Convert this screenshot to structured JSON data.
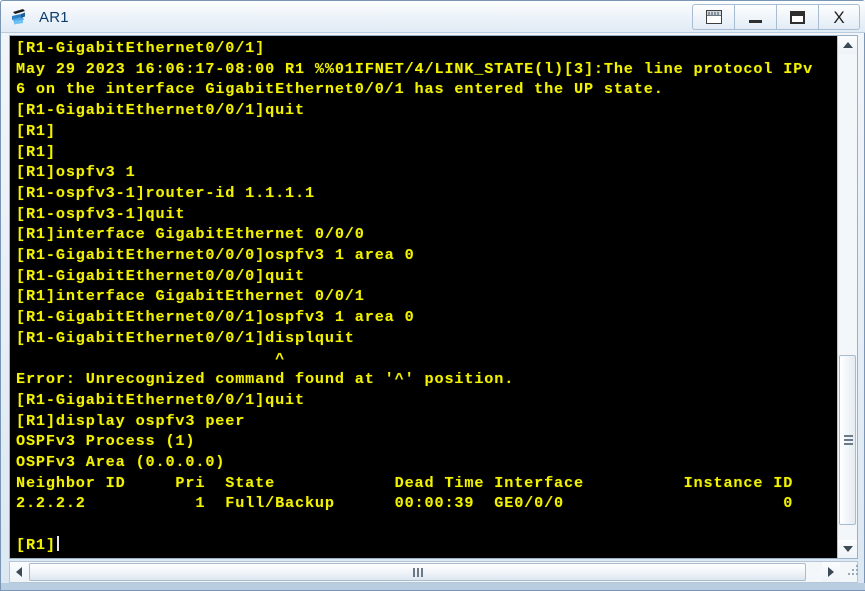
{
  "window": {
    "title": "AR1",
    "icon": "router-icon",
    "controls": [
      {
        "name": "restore-button",
        "glyph": "restore-icon",
        "label": "Restore"
      },
      {
        "name": "minimize-button",
        "glyph": "minimize-icon",
        "label": "Minimize"
      },
      {
        "name": "maximize-button",
        "glyph": "maximize-icon",
        "label": "Maximize"
      },
      {
        "name": "close-button",
        "glyph": "close-icon",
        "label": "X"
      }
    ]
  },
  "terminal": {
    "foreground_color": "#f2f200",
    "background_color": "#000000",
    "prompt": "[R1]",
    "cursor_visible": true,
    "lines": [
      "[R1-GigabitEthernet0/0/1]",
      "May 29 2023 16:06:17-08:00 R1 %%01IFNET/4/LINK_STATE(l)[3]:The line protocol IPv",
      "6 on the interface GigabitEthernet0/0/1 has entered the UP state.",
      "[R1-GigabitEthernet0/0/1]quit",
      "[R1]",
      "[R1]",
      "[R1]ospfv3 1",
      "[R1-ospfv3-1]router-id 1.1.1.1",
      "[R1-ospfv3-1]quit",
      "[R1]interface GigabitEthernet 0/0/0",
      "[R1-GigabitEthernet0/0/0]ospfv3 1 area 0",
      "[R1-GigabitEthernet0/0/0]quit",
      "[R1]interface GigabitEthernet 0/0/1",
      "[R1-GigabitEthernet0/0/1]ospfv3 1 area 0",
      "[R1-GigabitEthernet0/0/1]displquit",
      "                          ^",
      "Error: Unrecognized command found at '^' position.",
      "[R1-GigabitEthernet0/0/1]quit",
      "[R1]display ospfv3 peer",
      "OSPFv3 Process (1)",
      "OSPFv3 Area (0.0.0.0)",
      "Neighbor ID     Pri  State            Dead Time Interface          Instance ID",
      "2.2.2.2           1  Full/Backup      00:00:39  GE0/0/0                      0",
      "",
      "[R1]"
    ],
    "peer_table": {
      "process": "OSPFv3 Process (1)",
      "area": "OSPFv3 Area (0.0.0.0)",
      "columns": [
        "Neighbor ID",
        "Pri",
        "State",
        "Dead Time",
        "Interface",
        "Instance ID"
      ],
      "rows": [
        [
          "2.2.2.2",
          "1",
          "Full/Backup",
          "00:00:39",
          "GE0/0/0",
          "0"
        ]
      ]
    }
  },
  "scrollbars": {
    "vertical": {
      "up_arrow": "scroll-up-arrow",
      "down_arrow": "scroll-down-arrow",
      "thumb": "vertical-scroll-thumb"
    },
    "horizontal": {
      "left_arrow": "scroll-left-arrow",
      "right_arrow": "scroll-right-arrow",
      "thumb": "horizontal-scroll-thumb"
    }
  }
}
